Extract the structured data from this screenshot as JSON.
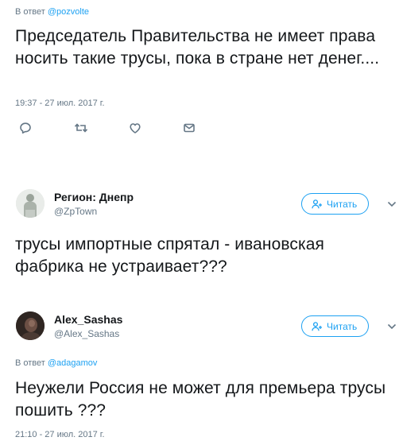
{
  "tweet1": {
    "reply_prefix": "В ответ",
    "reply_to": "@pozvolte",
    "text": "Председатель Правительства не имеет права носить такие трусы, пока в стране нет денег....",
    "timestamp": "19:37 - 27 июл. 2017 г."
  },
  "tweet2": {
    "name": "Регион: Днепр",
    "handle": "@ZpTown",
    "follow_label": "Читать",
    "text": "трусы импортные спрятал - ивановская фабрика не устраивает???"
  },
  "tweet3": {
    "name": "Alex_Sashas",
    "handle": "@Alex_Sashas",
    "follow_label": "Читать",
    "reply_prefix": "В ответ",
    "reply_to": "@adagamov",
    "text": "Неужели Россия не может для премьера трусы пошить ???",
    "timestamp": "21:10 - 27 июл. 2017 г."
  },
  "colors": {
    "accent": "#1da1f2",
    "muted": "#657786",
    "text": "#14171a"
  },
  "icons": [
    "reply-icon",
    "retweet-icon",
    "like-icon",
    "message-icon",
    "follow-user-icon",
    "chevron-down-icon"
  ]
}
